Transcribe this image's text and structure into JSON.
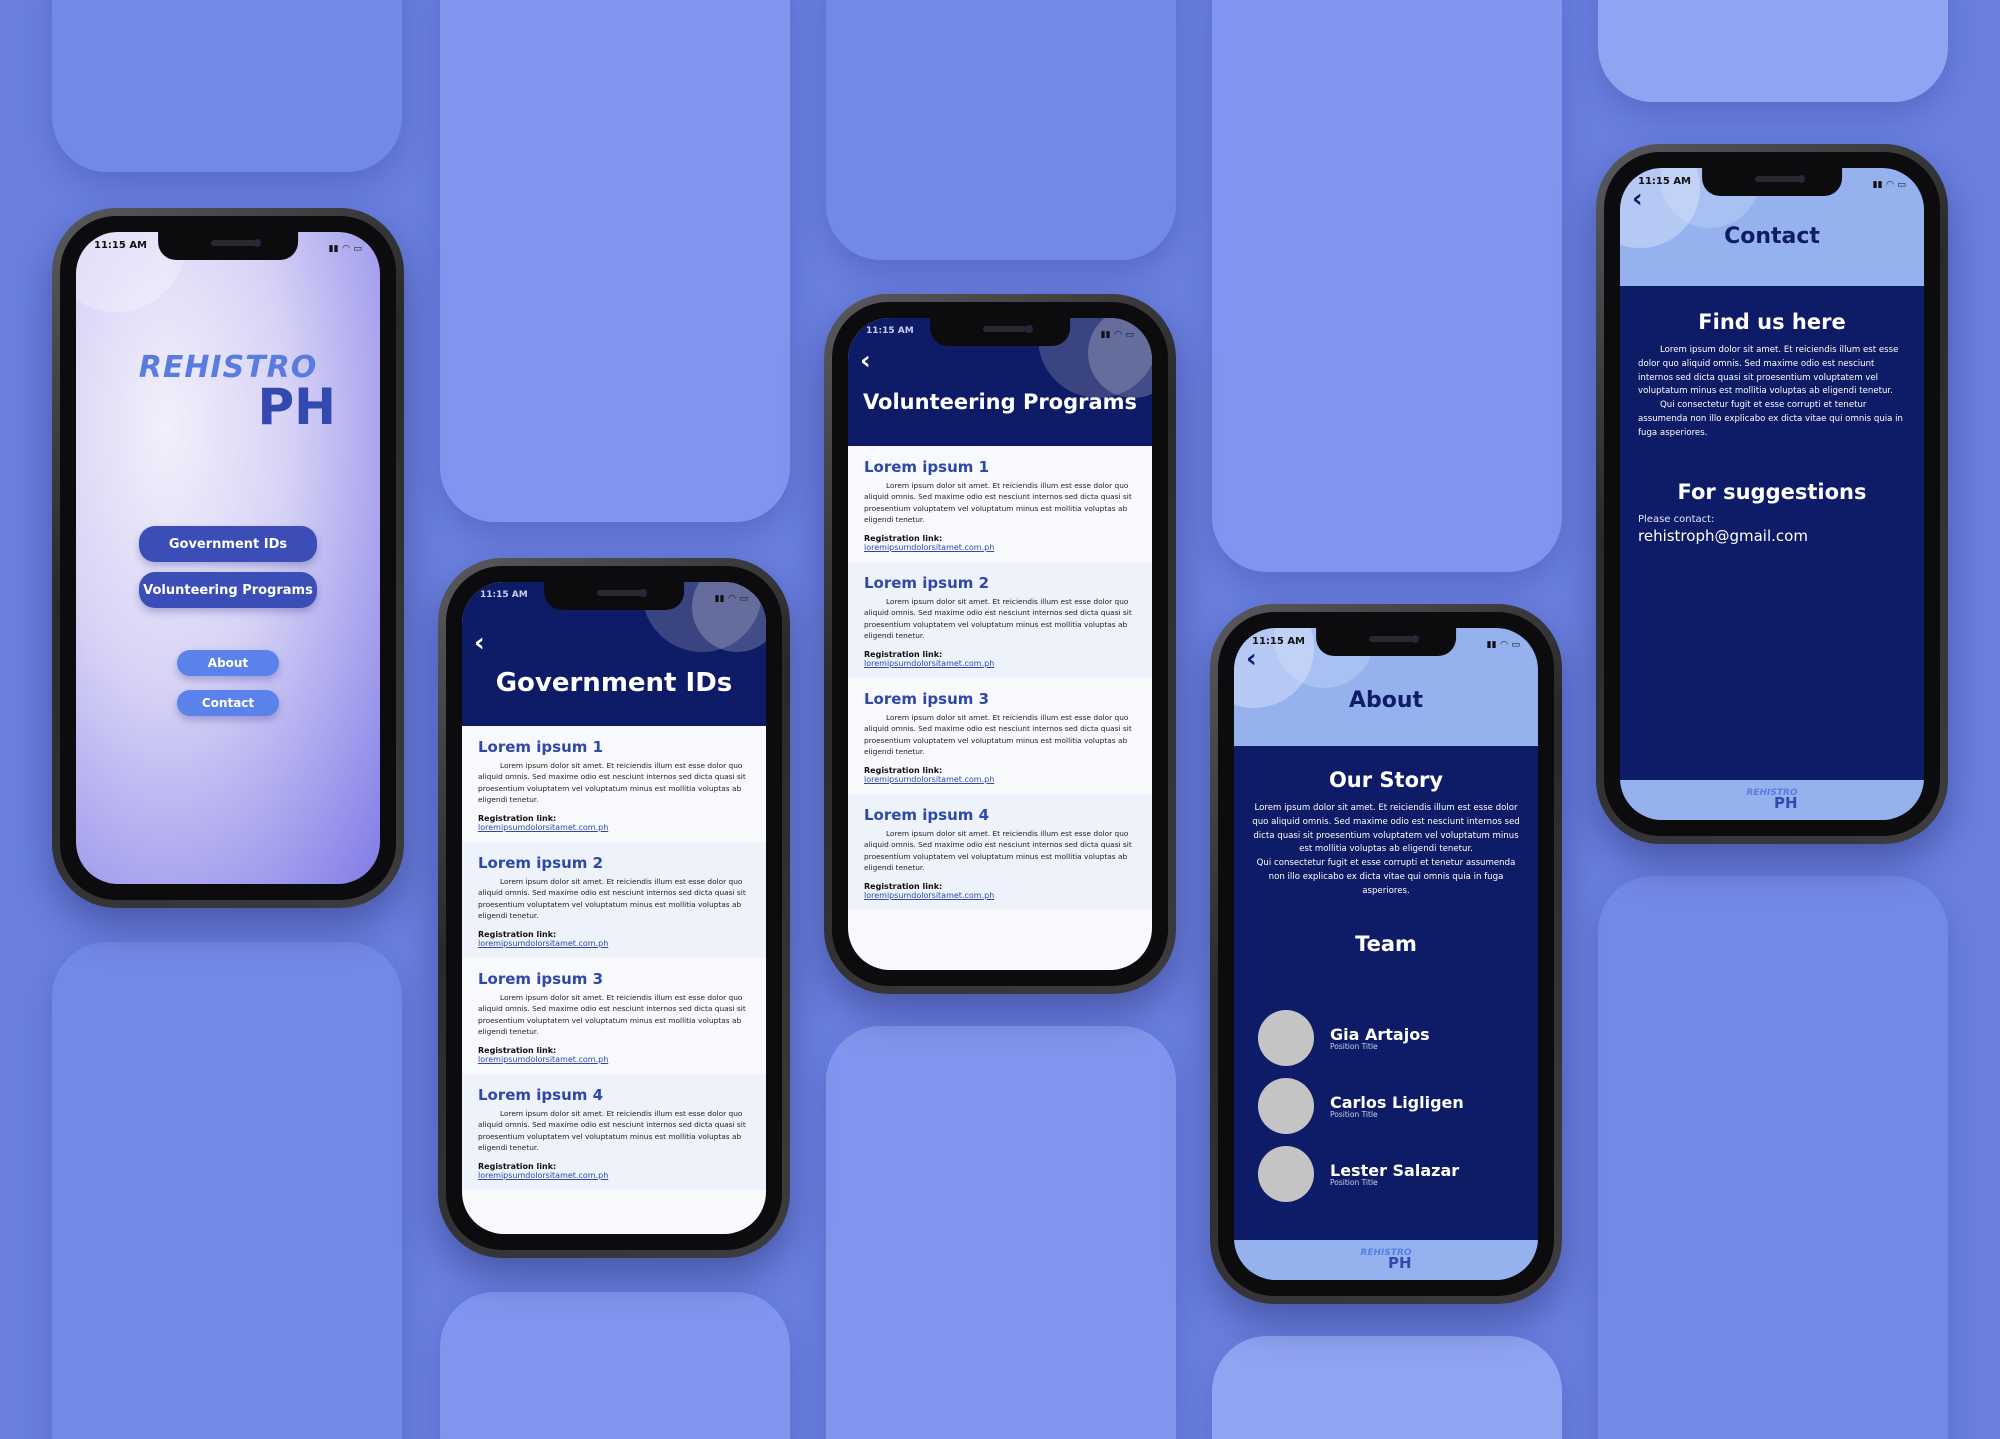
{
  "app": {
    "logo_top": "REHISTRO",
    "logo_bottom": "PH"
  },
  "status_time": "11:15 AM",
  "home": {
    "buttons": {
      "government_ids": "Government IDs",
      "volunteering_programs": "Volunteering Programs",
      "about": "About",
      "contact": "Contact"
    }
  },
  "government_ids": {
    "title": "Government IDs",
    "items": [
      {
        "title": "Lorem ipsum 1",
        "body": "Lorem ipsum dolor sit amet. Et reiciendis illum est esse dolor quo aliquid omnis. Sed maxime odio est nesciunt internos sed dicta quasi sit proesentium voluptatem vel voluptatum minus est mollitia voluptas ab eligendi tenetur.",
        "reg_label": "Registration link:",
        "link": "loremipsumdolorsitamet.com.ph"
      },
      {
        "title": "Lorem ipsum 2",
        "body": "Lorem ipsum dolor sit amet. Et reiciendis illum est esse dolor quo aliquid omnis. Sed maxime odio est nesciunt internos sed dicta quasi sit proesentium voluptatem vel voluptatum minus est mollitia voluptas ab eligendi tenetur.",
        "reg_label": "Registration link:",
        "link": "loremipsumdolorsitamet.com.ph"
      },
      {
        "title": "Lorem ipsum 3",
        "body": "Lorem ipsum dolor sit amet. Et reiciendis illum est esse dolor quo aliquid omnis. Sed maxime odio est nesciunt internos sed dicta quasi sit proesentium voluptatem vel voluptatum minus est mollitia voluptas ab eligendi tenetur.",
        "reg_label": "Registration link:",
        "link": "loremipsumdolorsitamet.com.ph"
      },
      {
        "title": "Lorem ipsum 4",
        "body": "Lorem ipsum dolor sit amet. Et reiciendis illum est esse dolor quo aliquid omnis. Sed maxime odio est nesciunt internos sed dicta quasi sit proesentium voluptatem vel voluptatum minus est mollitia voluptas ab eligendi tenetur.",
        "reg_label": "Registration link:",
        "link": "loremipsumdolorsitamet.com.ph"
      }
    ]
  },
  "volunteering": {
    "title": "Volunteering Programs",
    "items": [
      {
        "title": "Lorem ipsum 1",
        "body": "Lorem ipsum dolor sit amet. Et reiciendis illum est esse dolor quo aliquid omnis. Sed maxime odio est nesciunt internos sed dicta quasi sit proesentium voluptatem vel voluptatum minus est mollitia voluptas ab eligendi tenetur.",
        "reg_label": "Registration link:",
        "link": "loremipsumdolorsitamet.com.ph"
      },
      {
        "title": "Lorem ipsum 2",
        "body": "Lorem ipsum dolor sit amet. Et reiciendis illum est esse dolor quo aliquid omnis. Sed maxime odio est nesciunt internos sed dicta quasi sit proesentium voluptatem vel voluptatum minus est mollitia voluptas ab eligendi tenetur.",
        "reg_label": "Registration link:",
        "link": "loremipsumdolorsitamet.com.ph"
      },
      {
        "title": "Lorem ipsum 3",
        "body": "Lorem ipsum dolor sit amet. Et reiciendis illum est esse dolor quo aliquid omnis. Sed maxime odio est nesciunt internos sed dicta quasi sit proesentium voluptatem vel voluptatum minus est mollitia voluptas ab eligendi tenetur.",
        "reg_label": "Registration link:",
        "link": "loremipsumdolorsitamet.com.ph"
      },
      {
        "title": "Lorem ipsum 4",
        "body": "Lorem ipsum dolor sit amet. Et reiciendis illum est esse dolor quo aliquid omnis. Sed maxime odio est nesciunt internos sed dicta quasi sit proesentium voluptatem vel voluptatum minus est mollitia voluptas ab eligendi tenetur.",
        "reg_label": "Registration link:",
        "link": "loremipsumdolorsitamet.com.ph"
      }
    ]
  },
  "about": {
    "title": "About",
    "story_title": "Our Story",
    "story_p1": "Lorem ipsum dolor sit amet. Et reiciendis illum est esse dolor quo aliquid omnis. Sed maxime odio est nesciunt internos sed dicta quasi sit proesentium voluptatem vel voluptatum minus est mollitia voluptas ab eligendi tenetur.",
    "story_p2": "Qui consectetur fugit et esse corrupti et tenetur assumenda non illo explicabo ex dicta vitae qui omnis quia in fuga asperiores.",
    "team_title": "Team",
    "team": [
      {
        "name": "Gia Artajos",
        "position": "Position Title"
      },
      {
        "name": "Carlos Ligligen",
        "position": "Position Title"
      },
      {
        "name": "Lester Salazar",
        "position": "Position Title"
      }
    ]
  },
  "contact": {
    "title": "Contact",
    "find_title": "Find us here",
    "find_p1": "Lorem ipsum dolor sit amet. Et reiciendis illum est esse dolor quo aliquid omnis. Sed maxime odio est nesciunt internos sed dicta quasi sit proesentium voluptatem vel voluptatum minus est mollitia voluptas ab eligendi tenetur.",
    "find_p2": "Qui consectetur fugit et esse corrupti et tenetur assumenda non illo explicabo ex dicta vitae qui omnis quia in fuga asperiores.",
    "suggest_title": "For suggestions",
    "please_contact": "Please contact:",
    "email": "rehistroph@gmail.com"
  },
  "colors": {
    "background": "#6a7fe0",
    "navy": "#0e1b66",
    "accent_blue": "#3b4db6",
    "light_blue": "#95b2ef",
    "link_blue": "#2f49a8"
  },
  "icons": [
    "back-chevron-icon",
    "signal-icon",
    "wifi-icon",
    "battery-icon"
  ]
}
